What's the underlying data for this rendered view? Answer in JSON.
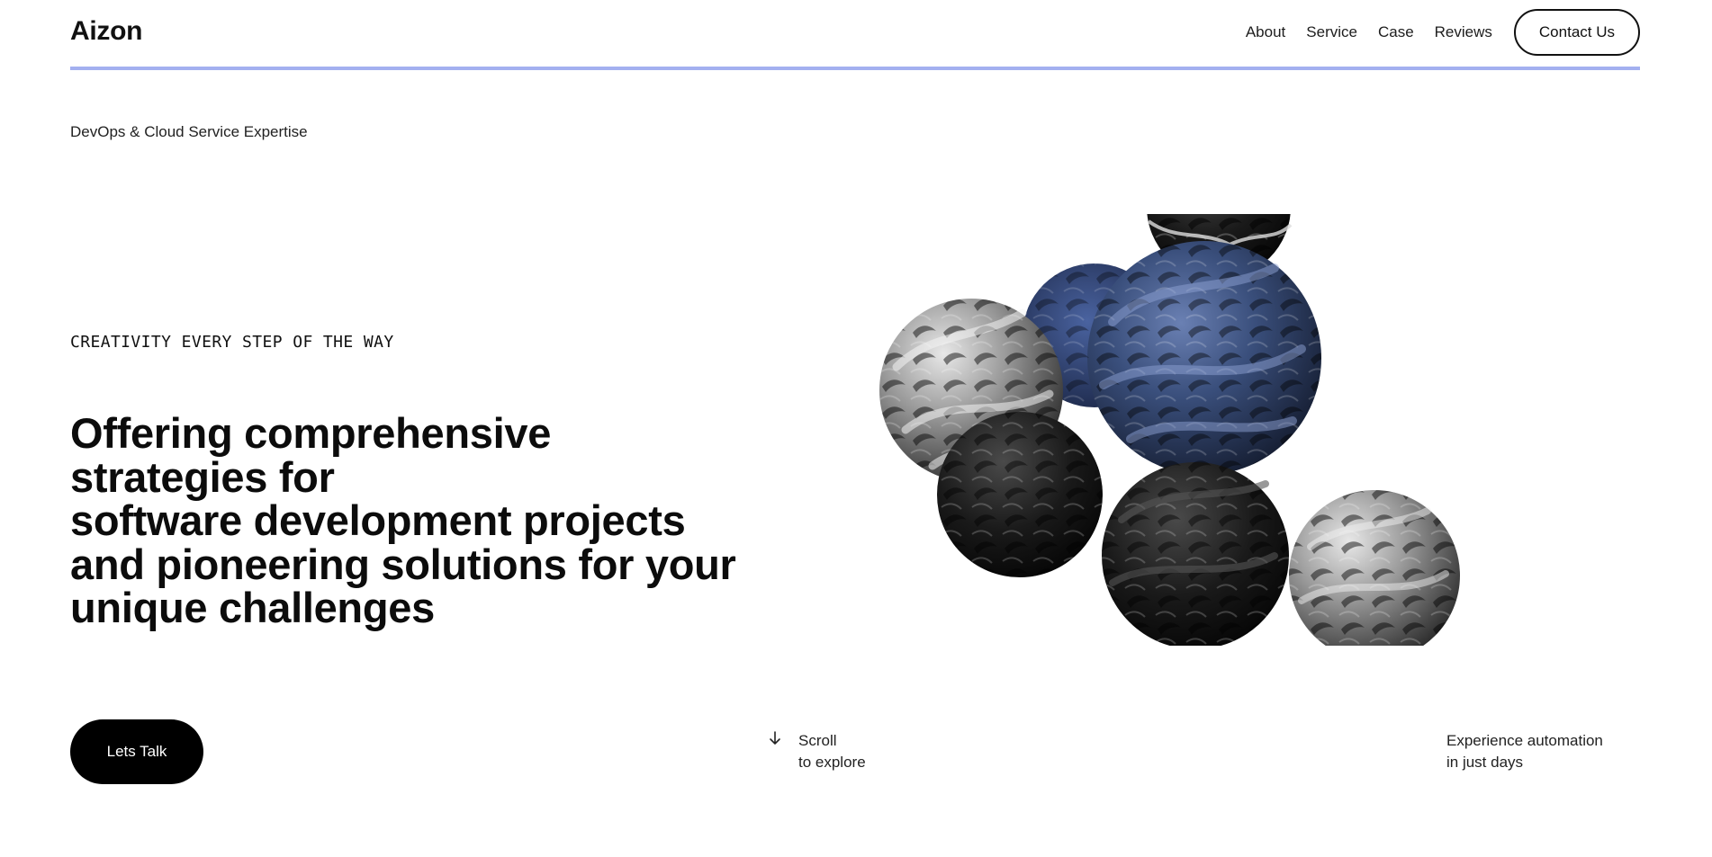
{
  "brand": {
    "logo_text": "Aizon"
  },
  "nav": {
    "links": [
      "About",
      "Service",
      "Case",
      "Reviews"
    ],
    "contact_label": "Contact Us"
  },
  "hero": {
    "eyebrow": "DevOps & Cloud Service Expertise",
    "kicker": "CREATIVITY EVERY STEP OF THE WAY",
    "headline_lines": [
      "Offering comprehensive",
      "strategies for",
      "software development projects",
      "and pioneering solutions for your",
      "unique challenges"
    ],
    "cta_label": "Lets Talk",
    "scroll": {
      "line1": "Scroll",
      "line2": "to explore"
    },
    "tagline": {
      "line1": "Experience automation",
      "line2": "in just days"
    }
  },
  "colors": {
    "accent_rule": "#a3b0f0",
    "cta_bg": "#000000",
    "sphere_blue": "#34466e"
  },
  "icons": {
    "scroll": "arrow-down-icon",
    "hero": "abstract-spheres-illustration"
  }
}
